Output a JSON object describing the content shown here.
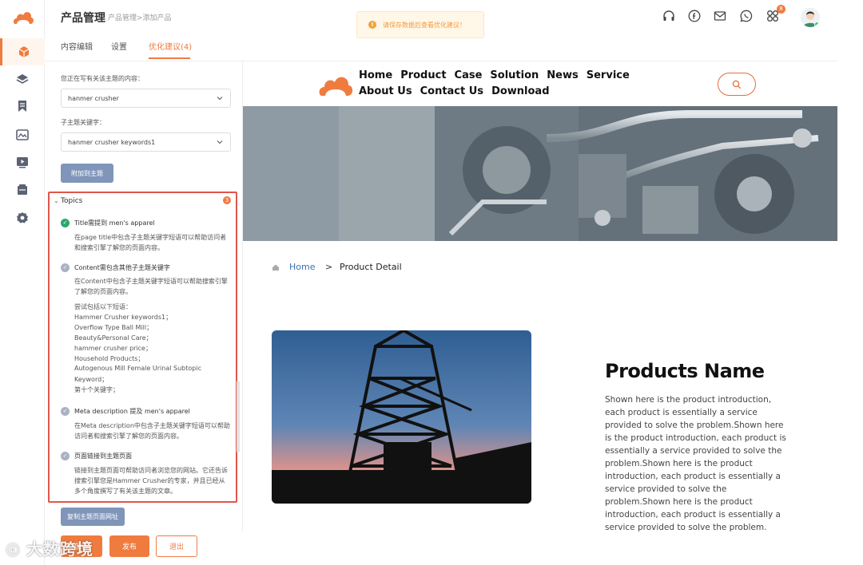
{
  "app": {
    "title": "产品管理",
    "breadcrumb": "产品管理>添加产品",
    "toast": "请保存数据后查看优化建议！",
    "notification_count": "8"
  },
  "sidebar_rail": {
    "items": [
      {
        "icon": "cube-icon",
        "active": true
      },
      {
        "icon": "layers-icon",
        "active": false
      },
      {
        "icon": "bookmark-icon",
        "active": false
      },
      {
        "icon": "image-icon",
        "active": false
      },
      {
        "icon": "video-icon",
        "active": false
      },
      {
        "icon": "folder-icon",
        "active": false
      },
      {
        "icon": "settings-icon",
        "active": false
      }
    ]
  },
  "header_icons": [
    "headset-icon",
    "facebook-icon",
    "mail-icon",
    "whatsapp-icon",
    "apps-icon"
  ],
  "tabs": [
    {
      "label": "内容编辑"
    },
    {
      "label": "设置"
    },
    {
      "label": "优化建议(4)"
    }
  ],
  "form": {
    "topic_label": "您正在写有关该主题的内容：",
    "topic_value": "hanmer crusher",
    "subtopic_label": "子主题关键字：",
    "subtopic_value": "hanmer crusher keywords1",
    "attach_button": "附加到主题"
  },
  "topics": {
    "header": "Topics",
    "badge": "3",
    "items": [
      {
        "status": "done",
        "title": "Title需提到 men's apparel",
        "desc": "在page title中包含子主题关键字短语可以帮助访问者和搜索引擎了解您的页面内容。"
      },
      {
        "status": "pending",
        "title": "Content需包含其他子主题关键字",
        "desc": "在Content中包含子主题关键字短语可以帮助搜索引擎了解您的页面内容。"
      },
      {
        "status": "pending",
        "title": "Meta description 提及 men's apparel",
        "desc": "在Meta description中包含子主题关键字短语可以帮助访问者和搜索引擎了解您的页面内容。"
      },
      {
        "status": "pending",
        "title": "页面链接到主题页面",
        "desc": "链接到主题页面可帮助访问者浏览您的网站。它还告诉搜索引擎您是Hammer Crusher的专家，并且已经从多个角度撰写了有关该主题的文章。"
      }
    ],
    "phrases_intro": "尝试包括以下短语：",
    "phrases": [
      "Hammer Crusher keywords1；",
      "Overflow Type Ball Mill；",
      "Beauty&Personal Care；",
      "hammer crusher price；",
      "Household Products；",
      "Autogenous Mill Female Urinal Subtopic",
      "Keyword；",
      "第十个关键字；"
    ]
  },
  "copy_button": "复制主题页面网址",
  "footer": {
    "save_label": "保存",
    "publish_label": "发布",
    "exit_label": "退出"
  },
  "watermark": "大数跨境",
  "preview": {
    "nav": [
      "Home",
      "Product",
      "Case",
      "Solution",
      "News",
      "Service",
      "About Us",
      "Contact Us",
      "Download"
    ],
    "breadcrumb_home": "Home",
    "breadcrumb_sep": ">",
    "breadcrumb_current": "Product Detail",
    "product_name": "Products Name",
    "product_desc": "Shown here is the product introduction, each product is essentially a service provided to solve the problem.Shown here is the product introduction, each product is essentially a service provided to solve the problem.Shown here is the product introduction, each product is essentially a service provided to solve the problem.Shown here is the product introduction, each product is essentially a service provided to solve the problem."
  },
  "colors": {
    "accent": "#f07b3f",
    "highlight_border": "#e0564c",
    "button_blue": "#7f95b9",
    "link_blue": "#3b6fb6"
  }
}
